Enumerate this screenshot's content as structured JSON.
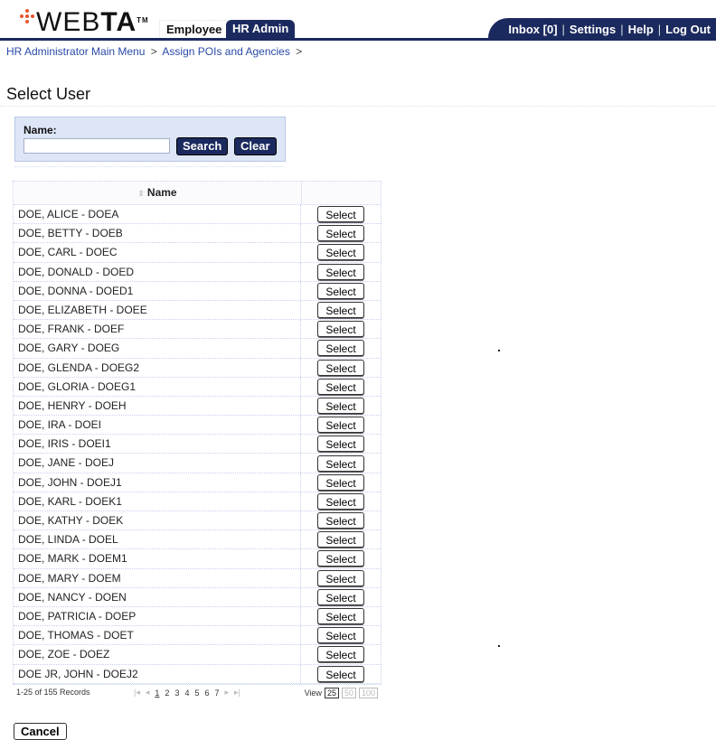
{
  "header": {
    "logo_text_light": "WEB",
    "logo_text_bold": "TA",
    "logo_tm": "TM",
    "tabs": [
      {
        "label": "Employee",
        "active": false
      },
      {
        "label": "HR Admin",
        "active": true
      }
    ],
    "utility_nav": [
      "Inbox [0]",
      "Settings",
      "Help",
      "Log Out"
    ],
    "colors": {
      "brand_navy": "#1b2a5e",
      "logo_dot": "#e8552a"
    }
  },
  "breadcrumb": {
    "items": [
      "HR Administrator Main Menu",
      "Assign POIs and Agencies"
    ],
    "separator": ">"
  },
  "page_title": "Select User",
  "search": {
    "label": "Name:",
    "value": "",
    "placeholder": "",
    "search_label": "Search",
    "clear_label": "Clear"
  },
  "table": {
    "columns": [
      "Name",
      ""
    ],
    "select_label": "Select",
    "rows": [
      "DOE, ALICE - DOEA",
      "DOE, BETTY - DOEB",
      "DOE, CARL - DOEC",
      "DOE, DONALD - DOED",
      "DOE, DONNA - DOED1",
      "DOE, ELIZABETH - DOEE",
      "DOE, FRANK - DOEF",
      "DOE, GARY - DOEG",
      "DOE, GLENDA - DOEG2",
      "DOE, GLORIA - DOEG1",
      "DOE, HENRY - DOEH",
      "DOE, IRA - DOEI",
      "DOE, IRIS - DOEI1",
      "DOE, JANE - DOEJ",
      "DOE, JOHN - DOEJ1",
      "DOE, KARL - DOEK1",
      "DOE, KATHY - DOEK",
      "DOE, LINDA - DOEL",
      "DOE, MARK - DOEM1",
      "DOE, MARY - DOEM",
      "DOE, NANCY - DOEN",
      "DOE, PATRICIA - DOEP",
      "DOE, THOMAS - DOET",
      "DOE, ZOE - DOEZ",
      "DOE JR, JOHN - DOEJ2"
    ]
  },
  "pager": {
    "record_text": "1-25 of 155 Records",
    "first": "|◂",
    "prev": "◂",
    "pages": [
      "1",
      "2",
      "3",
      "4",
      "5",
      "6",
      "7"
    ],
    "current_page": "1",
    "next": "▸",
    "last": "▸|",
    "view_label": "View",
    "view_options": [
      "25",
      "50",
      "100"
    ],
    "view_selected": "25"
  },
  "cancel_label": "Cancel"
}
